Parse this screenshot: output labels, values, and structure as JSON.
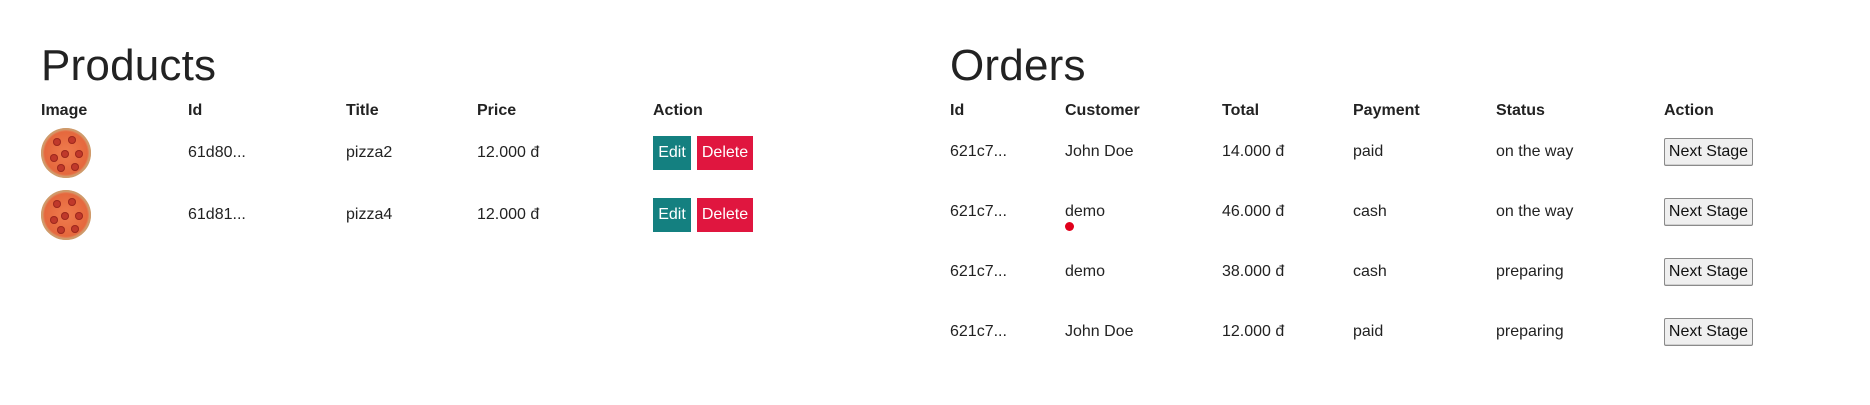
{
  "products": {
    "title": "Products",
    "columns": [
      "Image",
      "Id",
      "Title",
      "Price",
      "Action"
    ],
    "rows": [
      {
        "image_icon": "pizza-image",
        "id": "61d80...",
        "title": "pizza2",
        "price": "12.000 đ",
        "edit_label": "Edit",
        "delete_label": "Delete"
      },
      {
        "image_icon": "pizza-image",
        "id": "61d81...",
        "title": "pizza4",
        "price": "12.000 đ",
        "edit_label": "Edit",
        "delete_label": "Delete"
      }
    ],
    "colors": {
      "edit": "#148080",
      "delete": "#e0163f"
    }
  },
  "orders": {
    "title": "Orders",
    "columns": [
      "Id",
      "Customer",
      "Total",
      "Payment",
      "Status",
      "Action"
    ],
    "rows": [
      {
        "id": "621c7...",
        "customer": "John Doe",
        "total": "14.000 đ",
        "payment": "paid",
        "status": "on the way",
        "action_label": "Next Stage"
      },
      {
        "id": "621c7...",
        "customer": "demo",
        "total": "46.000 đ",
        "payment": "cash",
        "status": "on the way",
        "action_label": "Next Stage"
      },
      {
        "id": "621c7...",
        "customer": "demo",
        "total": "38.000 đ",
        "payment": "cash",
        "status": "preparing",
        "action_label": "Next Stage"
      },
      {
        "id": "621c7...",
        "customer": "John Doe",
        "total": "12.000 đ",
        "payment": "paid",
        "status": "preparing",
        "action_label": "Next Stage"
      }
    ]
  }
}
